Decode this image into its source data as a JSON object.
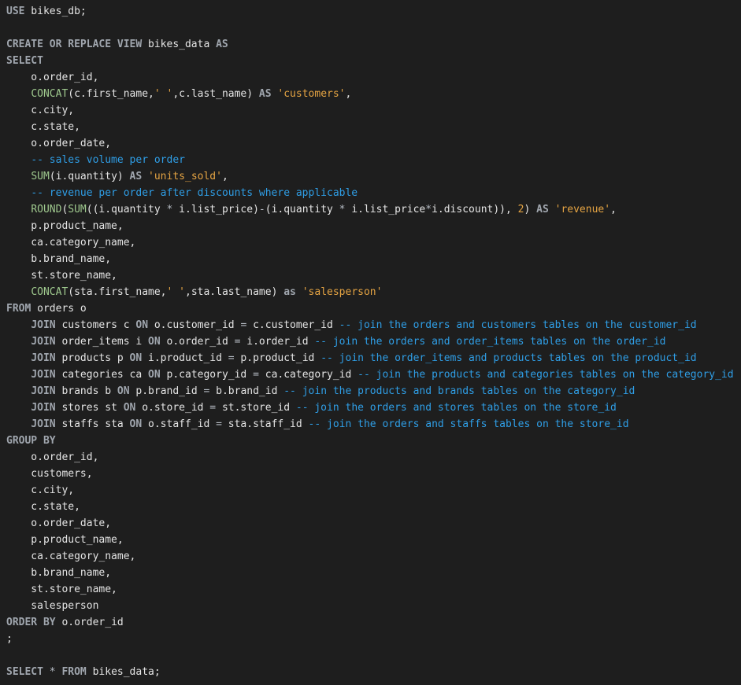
{
  "editor": {
    "language": "sql",
    "lines": [
      [
        [
          "kw",
          "USE"
        ],
        [
          "plain",
          " bikes_db;"
        ]
      ],
      [],
      [
        [
          "kw",
          "CREATE OR REPLACE VIEW"
        ],
        [
          "plain",
          " bikes_data "
        ],
        [
          "kw",
          "AS"
        ]
      ],
      [
        [
          "kw",
          "SELECT"
        ]
      ],
      [
        [
          "plain",
          "    o.order_id,"
        ]
      ],
      [
        [
          "plain",
          "    "
        ],
        [
          "fn",
          "CONCAT"
        ],
        [
          "plain",
          "(c.first_name,"
        ],
        [
          "str",
          "' '"
        ],
        [
          "plain",
          ",c.last_name) "
        ],
        [
          "kw",
          "AS"
        ],
        [
          "plain",
          " "
        ],
        [
          "str",
          "'customers'"
        ],
        [
          "plain",
          ","
        ]
      ],
      [
        [
          "plain",
          "    c.city,"
        ]
      ],
      [
        [
          "plain",
          "    c.state,"
        ]
      ],
      [
        [
          "plain",
          "    o.order_date,"
        ]
      ],
      [
        [
          "plain",
          "    "
        ],
        [
          "cm",
          "-- sales volume per order"
        ]
      ],
      [
        [
          "plain",
          "    "
        ],
        [
          "fn",
          "SUM"
        ],
        [
          "plain",
          "(i.quantity) "
        ],
        [
          "kw",
          "AS"
        ],
        [
          "plain",
          " "
        ],
        [
          "str",
          "'units_sold'"
        ],
        [
          "plain",
          ","
        ]
      ],
      [
        [
          "plain",
          "    "
        ],
        [
          "cm",
          "-- revenue per order after discounts where applicable"
        ]
      ],
      [
        [
          "plain",
          "    "
        ],
        [
          "fn",
          "ROUND"
        ],
        [
          "plain",
          "("
        ],
        [
          "fn",
          "SUM"
        ],
        [
          "plain",
          "((i.quantity "
        ],
        [
          "op",
          "*"
        ],
        [
          "plain",
          " i.list_price)"
        ],
        [
          "op",
          "-"
        ],
        [
          "plain",
          "(i.quantity "
        ],
        [
          "op",
          "*"
        ],
        [
          "plain",
          " i.list_price"
        ],
        [
          "op",
          "*"
        ],
        [
          "plain",
          "i.discount)), "
        ],
        [
          "num",
          "2"
        ],
        [
          "plain",
          ") "
        ],
        [
          "kw",
          "AS"
        ],
        [
          "plain",
          " "
        ],
        [
          "str",
          "'revenue'"
        ],
        [
          "plain",
          ","
        ]
      ],
      [
        [
          "plain",
          "    p.product_name,"
        ]
      ],
      [
        [
          "plain",
          "    ca.category_name,"
        ]
      ],
      [
        [
          "plain",
          "    b.brand_name,"
        ]
      ],
      [
        [
          "plain",
          "    st.store_name,"
        ]
      ],
      [
        [
          "plain",
          "    "
        ],
        [
          "fn",
          "CONCAT"
        ],
        [
          "plain",
          "(sta.first_name,"
        ],
        [
          "str",
          "' '"
        ],
        [
          "plain",
          ",sta.last_name) "
        ],
        [
          "kw",
          "as"
        ],
        [
          "plain",
          " "
        ],
        [
          "str",
          "'salesperson'"
        ]
      ],
      [
        [
          "kw",
          "FROM"
        ],
        [
          "plain",
          " orders o"
        ]
      ],
      [
        [
          "plain",
          "    "
        ],
        [
          "kw",
          "JOIN"
        ],
        [
          "plain",
          " customers c "
        ],
        [
          "kw",
          "ON"
        ],
        [
          "plain",
          " o.customer_id "
        ],
        [
          "op",
          "="
        ],
        [
          "plain",
          " c.customer_id "
        ],
        [
          "cm",
          "-- join the orders and customers tables on the customer_id"
        ]
      ],
      [
        [
          "plain",
          "    "
        ],
        [
          "kw",
          "JOIN"
        ],
        [
          "plain",
          " order_items i "
        ],
        [
          "kw",
          "ON"
        ],
        [
          "plain",
          " o.order_id "
        ],
        [
          "op",
          "="
        ],
        [
          "plain",
          " i.order_id "
        ],
        [
          "cm",
          "-- join the orders and order_items tables on the order_id"
        ]
      ],
      [
        [
          "plain",
          "    "
        ],
        [
          "kw",
          "JOIN"
        ],
        [
          "plain",
          " products p "
        ],
        [
          "kw",
          "ON"
        ],
        [
          "plain",
          " i.product_id "
        ],
        [
          "op",
          "="
        ],
        [
          "plain",
          " p.product_id "
        ],
        [
          "cm",
          "-- join the order_items and products tables on the product_id"
        ]
      ],
      [
        [
          "plain",
          "    "
        ],
        [
          "kw",
          "JOIN"
        ],
        [
          "plain",
          " categories ca "
        ],
        [
          "kw",
          "ON"
        ],
        [
          "plain",
          " p.category_id "
        ],
        [
          "op",
          "="
        ],
        [
          "plain",
          " ca.category_id "
        ],
        [
          "cm",
          "-- join the products and categories tables on the category_id"
        ]
      ],
      [
        [
          "plain",
          "    "
        ],
        [
          "kw",
          "JOIN"
        ],
        [
          "plain",
          " brands b "
        ],
        [
          "kw",
          "ON"
        ],
        [
          "plain",
          " p.brand_id "
        ],
        [
          "op",
          "="
        ],
        [
          "plain",
          " b.brand_id "
        ],
        [
          "cm",
          "-- join the products and brands tables on the category_id"
        ]
      ],
      [
        [
          "plain",
          "    "
        ],
        [
          "kw",
          "JOIN"
        ],
        [
          "plain",
          " stores st "
        ],
        [
          "kw",
          "ON"
        ],
        [
          "plain",
          " o.store_id "
        ],
        [
          "op",
          "="
        ],
        [
          "plain",
          " st.store_id "
        ],
        [
          "cm",
          "-- join the orders and stores tables on the store_id"
        ]
      ],
      [
        [
          "plain",
          "    "
        ],
        [
          "kw",
          "JOIN"
        ],
        [
          "plain",
          " staffs sta "
        ],
        [
          "kw",
          "ON"
        ],
        [
          "plain",
          " o.staff_id "
        ],
        [
          "op",
          "="
        ],
        [
          "plain",
          " sta.staff_id "
        ],
        [
          "cm",
          "-- join the orders and staffs tables on the store_id"
        ]
      ],
      [
        [
          "kw",
          "GROUP BY"
        ]
      ],
      [
        [
          "plain",
          "    o.order_id,"
        ]
      ],
      [
        [
          "plain",
          "    customers,"
        ]
      ],
      [
        [
          "plain",
          "    c.city,"
        ]
      ],
      [
        [
          "plain",
          "    c.state,"
        ]
      ],
      [
        [
          "plain",
          "    o.order_date,"
        ]
      ],
      [
        [
          "plain",
          "    p.product_name,"
        ]
      ],
      [
        [
          "plain",
          "    ca.category_name,"
        ]
      ],
      [
        [
          "plain",
          "    b.brand_name,"
        ]
      ],
      [
        [
          "plain",
          "    st.store_name,"
        ]
      ],
      [
        [
          "plain",
          "    salesperson"
        ]
      ],
      [
        [
          "kw",
          "ORDER BY"
        ],
        [
          "plain",
          " o.order_id"
        ]
      ],
      [
        [
          "plain",
          ";"
        ]
      ],
      [],
      [
        [
          "kw",
          "SELECT"
        ],
        [
          "plain",
          " "
        ],
        [
          "op",
          "*"
        ],
        [
          "plain",
          " "
        ],
        [
          "kw",
          "FROM"
        ],
        [
          "plain",
          " bikes_data;"
        ]
      ]
    ]
  }
}
